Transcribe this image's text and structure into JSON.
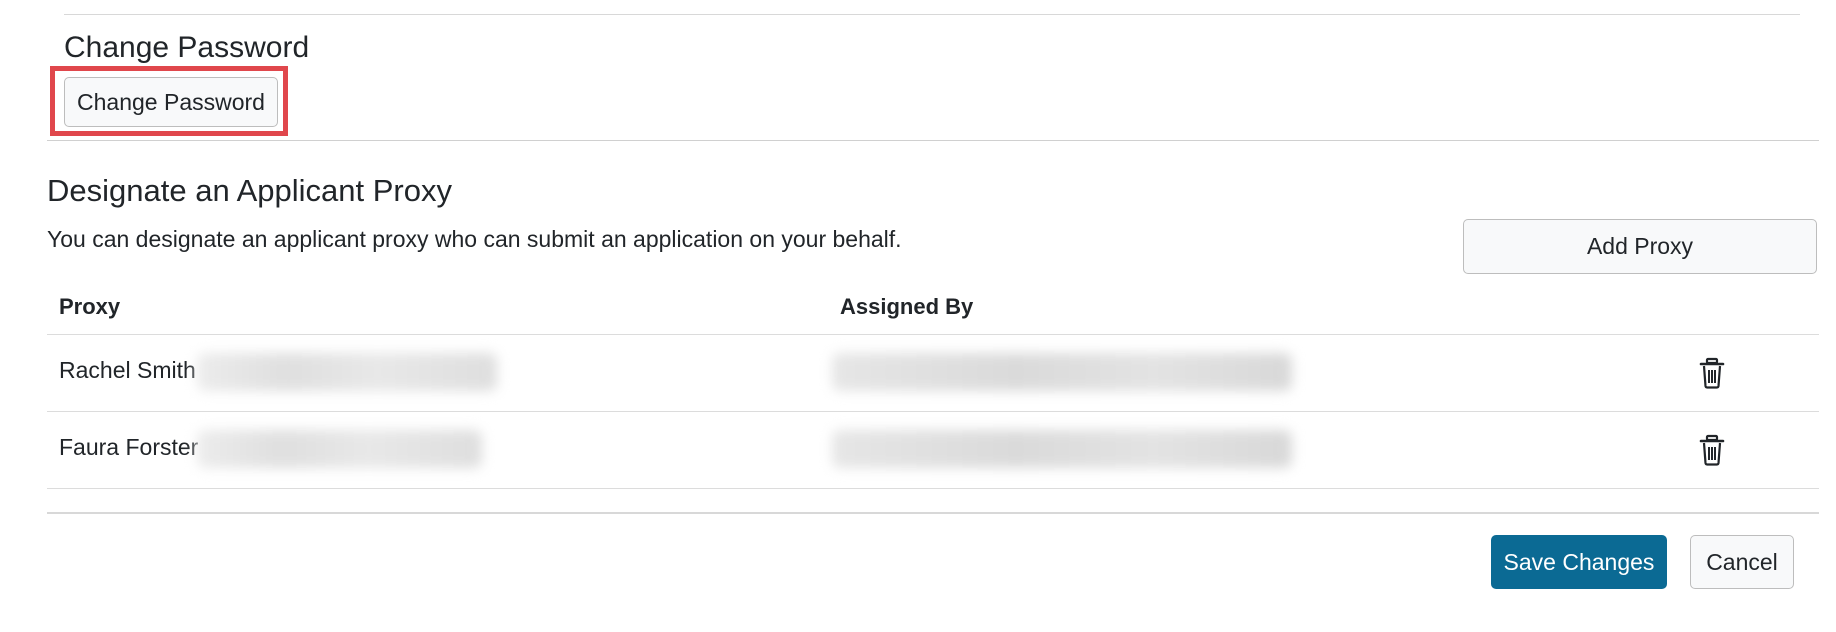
{
  "change_password": {
    "title": "Change Password",
    "button_label": "Change Password"
  },
  "proxy_section": {
    "title": "Designate an Applicant Proxy",
    "description": "You can designate an applicant proxy who can submit an application on your behalf.",
    "add_button_label": "Add Proxy",
    "table": {
      "headers": [
        "Proxy",
        "Assigned By"
      ],
      "rows": [
        {
          "name": "Rachel Smith",
          "delete_icon": "trash-icon"
        },
        {
          "name": "Faura Forster",
          "delete_icon": "trash-icon"
        }
      ]
    }
  },
  "footer": {
    "save_label": "Save Changes",
    "cancel_label": "Cancel"
  },
  "colors": {
    "primary": "#0b6a94",
    "highlight": "#e0474c"
  }
}
